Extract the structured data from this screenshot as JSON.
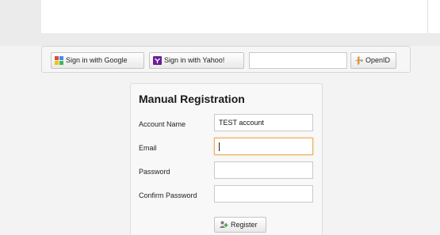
{
  "openid_bar": {
    "google_label": "Sign in with Google",
    "yahoo_label": "Sign in with Yahoo!",
    "openid_input_value": "",
    "openid_label": "OpenID"
  },
  "registration": {
    "title": "Manual Registration",
    "fields": [
      {
        "label": "Account Name",
        "value": "TEST account"
      },
      {
        "label": "Email",
        "value": ""
      },
      {
        "label": "Password",
        "value": ""
      },
      {
        "label": "Confirm Password",
        "value": ""
      }
    ],
    "register_label": "Register"
  },
  "icons": {
    "google": "google-icon",
    "yahoo": "yahoo-icon",
    "openid": "openid-icon",
    "register": "register-icon"
  },
  "colors": {
    "focus_border": "#e8b057",
    "yahoo_purple": "#6a1b9a",
    "openid_orange": "#f7941d"
  }
}
